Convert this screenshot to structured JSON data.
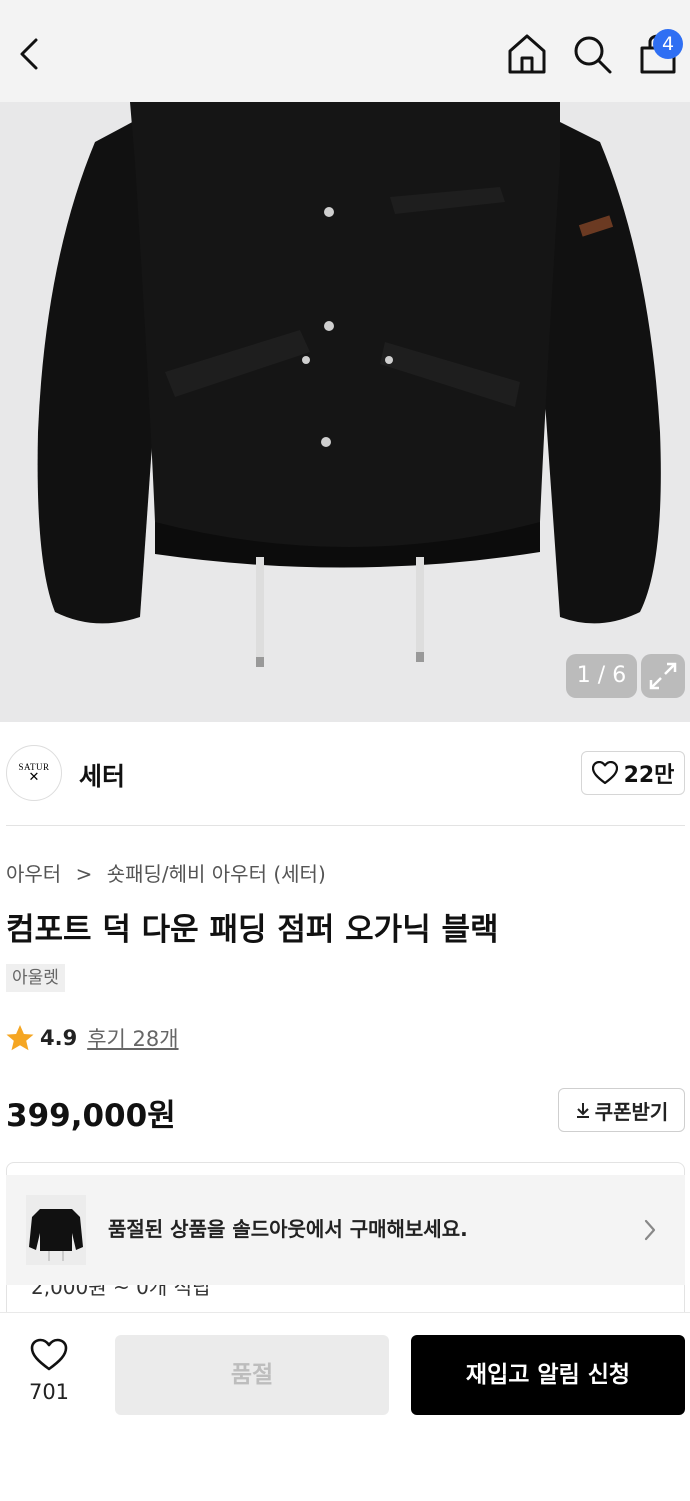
{
  "header": {
    "back_icon": "chevron-left-icon",
    "home_icon": "home-icon",
    "search_icon": "search-icon",
    "cart_icon": "shopping-bag-icon",
    "cart_count": "4",
    "badge_color": "#2f6ff3"
  },
  "gallery": {
    "counter": "1 / 6",
    "expand_icon": "expand-icon"
  },
  "brand": {
    "logo_text": "SATUR",
    "logo_mark": "✕",
    "name": "세터",
    "like_icon": "heart-icon",
    "like_count": "22만"
  },
  "product": {
    "breadcrumb": {
      "category": "아우터",
      "separator": ">",
      "subcategory": "숏패딩/헤비 아우터 (세터)"
    },
    "title": "컴포트 덕 다운 패딩 점퍼 오가닉 블랙",
    "tag": "아울렛",
    "rating": {
      "icon": "star-icon",
      "icon_color": "#f5a623",
      "value": "4.9",
      "review_label": "후기 28개"
    },
    "price": "399,000원",
    "coupon": {
      "icon": "download-icon",
      "label": "쿠폰받기"
    }
  },
  "info_box": {
    "partial_text": "2,000원 ~ 0개 적립"
  },
  "soldout_banner": {
    "text": "품절된 상품을 솔드아웃에서 구매해보세요.",
    "chevron_icon": "chevron-right-icon"
  },
  "bottom_bar": {
    "wish_icon": "heart-outline-icon",
    "wish_count": "701",
    "soldout_label": "품절",
    "restock_label": "재입고 알림 신청"
  }
}
